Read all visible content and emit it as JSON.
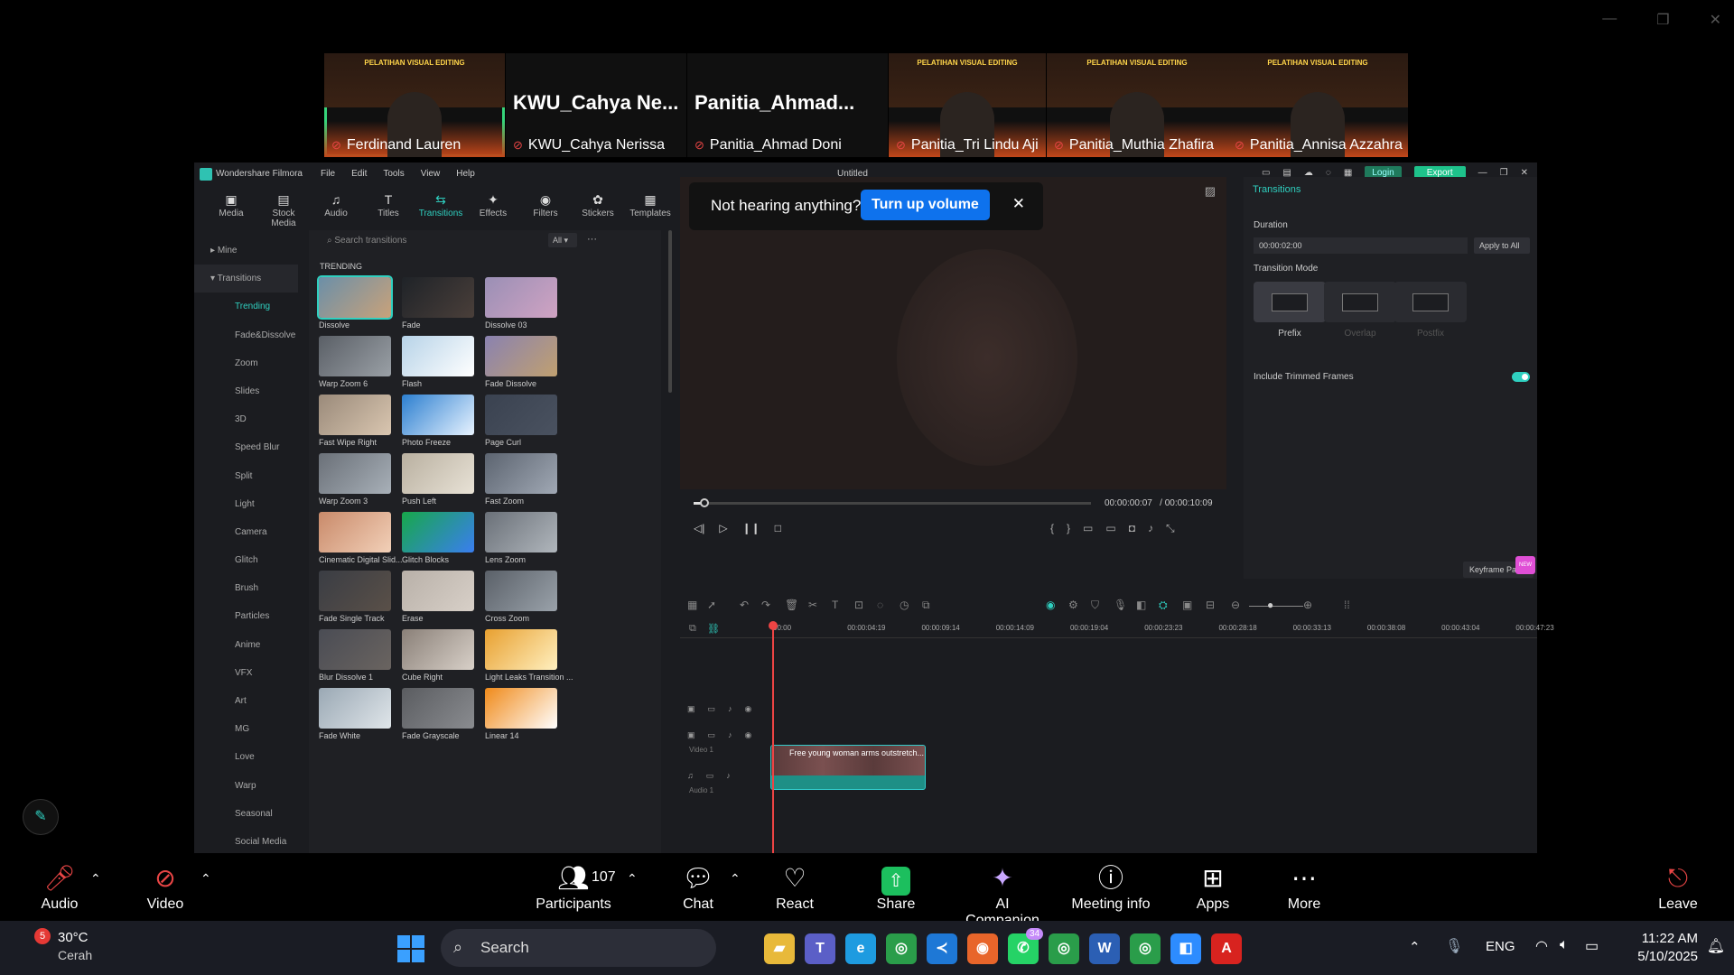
{
  "window_controls": [
    "—",
    "❐",
    "✕"
  ],
  "gallery": {
    "tiles": [
      {
        "name": "Ferdinand Lauren",
        "banner": "PELATIHAN VISUAL EDITING",
        "speaking": true,
        "video": true
      },
      {
        "name": "KWU_Cahya Nerissa",
        "big": "KWU_Cahya  Ne...",
        "video": false
      },
      {
        "name": "Panitia_Ahmad Doni",
        "big": "Panitia_Ahmad...",
        "video": false
      },
      {
        "name": "Panitia_Tri Lindu Aji",
        "banner": "PELATIHAN VISUAL EDITING",
        "video": true
      },
      {
        "name": "Panitia_Muthia Zhafira",
        "banner": "PELATIHAN VISUAL EDITING",
        "video": true
      },
      {
        "name": "Panitia_Annisa Azzahra",
        "banner": "PELATIHAN VISUAL EDITING",
        "video": true
      }
    ]
  },
  "filmora": {
    "app_name": "Wondershare Filmora",
    "menu": [
      "File",
      "Edit",
      "Tools",
      "View",
      "Help"
    ],
    "doc_title": "Untitled",
    "login": "Login",
    "export": "Export",
    "toolbar": [
      {
        "label": "Media",
        "icon": "▣"
      },
      {
        "label": "Stock Media",
        "icon": "▤"
      },
      {
        "label": "Audio",
        "icon": "♫"
      },
      {
        "label": "Titles",
        "icon": "T"
      },
      {
        "label": "Transitions",
        "icon": "⇆",
        "active": true
      },
      {
        "label": "Effects",
        "icon": "✦"
      },
      {
        "label": "Filters",
        "icon": "◉"
      },
      {
        "label": "Stickers",
        "icon": "✿"
      },
      {
        "label": "Templates",
        "icon": "▦"
      }
    ],
    "nav": {
      "mine": "Mine",
      "transitions": "Transitions",
      "items": [
        "Trending",
        "Fade&Dissolve",
        "Zoom",
        "Slides",
        "3D",
        "Speed Blur",
        "Split",
        "Light",
        "Camera",
        "Glitch",
        "Brush",
        "Particles",
        "Anime",
        "VFX",
        "Art",
        "MG",
        "Love",
        "Warp",
        "Seasonal",
        "Social Media"
      ]
    },
    "search_placeholder": "Search transitions",
    "filter": "All",
    "trending_header": "TRENDING",
    "transitions": [
      {
        "label": "Dissolve",
        "c1": "#6b8fa8",
        "c2": "#c9a27a"
      },
      {
        "label": "Fade",
        "c1": "#1f2328",
        "c2": "#4a3f3a"
      },
      {
        "label": "Dissolve 03",
        "c1": "#9a8fb5",
        "c2": "#d0a3c3"
      },
      {
        "label": "Warp Zoom 6",
        "c1": "#5a5f66",
        "c2": "#9aa0a6"
      },
      {
        "label": "Flash",
        "c1": "#b7d3e8",
        "c2": "#ffffff"
      },
      {
        "label": "Fade Dissolve",
        "c1": "#8a82b0",
        "c2": "#c0a070"
      },
      {
        "label": "Fast Wipe Right",
        "c1": "#9a8a7a",
        "c2": "#d9c6b0"
      },
      {
        "label": "Photo Freeze",
        "c1": "#2c7fd0",
        "c2": "#e8f3ff"
      },
      {
        "label": "Page Curl",
        "c1": "#3a4250",
        "c2": "#4a5260"
      },
      {
        "label": "Warp Zoom 3",
        "c1": "#6a7078",
        "c2": "#a8b0b8"
      },
      {
        "label": "Push Left",
        "c1": "#b9b0a0",
        "c2": "#e8e2d6"
      },
      {
        "label": "Fast Zoom",
        "c1": "#5c6470",
        "c2": "#a0a8b4"
      },
      {
        "label": "Cinematic Digital Slid...",
        "c1": "#c98a6a",
        "c2": "#f2d0b8"
      },
      {
        "label": "Glitch Blocks",
        "c1": "#17a84a",
        "c2": "#3a7ef0"
      },
      {
        "label": "Lens Zoom",
        "c1": "#6a7078",
        "c2": "#b0b6bc"
      },
      {
        "label": "Fade Single Track",
        "c1": "#3a3d44",
        "c2": "#5a5048"
      },
      {
        "label": "Erase",
        "c1": "#b8b0a8",
        "c2": "#d8d0c8"
      },
      {
        "label": "Cross Zoom",
        "c1": "#5a6068",
        "c2": "#9aa2aa"
      },
      {
        "label": "Blur Dissolve 1",
        "c1": "#4a4c54",
        "c2": "#6a6460"
      },
      {
        "label": "Cube Right",
        "c1": "#8a8078",
        "c2": "#d8d0c8"
      },
      {
        "label": "Light Leaks Transition ...",
        "c1": "#e8a030",
        "c2": "#fff0c0"
      },
      {
        "label": "Fade White",
        "c1": "#9aa8b4",
        "c2": "#e0e6ea"
      },
      {
        "label": "Fade Grayscale",
        "c1": "#5a5c60",
        "c2": "#8a8c90"
      },
      {
        "label": "Linear 14",
        "c1": "#f08a1a",
        "c2": "#ffffff"
      }
    ],
    "notice": {
      "text": "Not hearing anything?",
      "button": "Turn up volume",
      "close": "✕"
    },
    "player": {
      "current": "00:00:00:07",
      "total": "/ 00:00:10:09",
      "progress": 0.022
    },
    "props": {
      "tab": "Transitions",
      "duration_label": "Duration",
      "duration": "00:00:02:00",
      "apply_all": "Apply to All",
      "mode_label": "Transition Mode",
      "modes": [
        "Prefix",
        "Overlap",
        "Postfix"
      ],
      "include_trimmed": "Include Trimmed Frames",
      "keyframe": "Keyframe Panel",
      "new_badge": "NEW"
    },
    "ruler": [
      "00:00",
      "00:00:04:19",
      "00:00:09:14",
      "00:00:14:09",
      "00:00:19:04",
      "00:00:23:23",
      "00:00:28:18",
      "00:00:33:13",
      "00:00:38:08",
      "00:00:43:04",
      "00:00:47:23"
    ],
    "tracks": {
      "video": "Video 1",
      "audio": "Audio 1",
      "clip": "Free young woman arms outstretch..."
    }
  },
  "zoom": {
    "audio": "Audio",
    "video": "Video",
    "participants": "Participants",
    "participants_count": "107",
    "chat": "Chat",
    "react": "React",
    "share": "Share",
    "ai": "AI Companion",
    "meeting_info": "Meeting info",
    "apps": "Apps",
    "more": "More",
    "leave": "Leave"
  },
  "taskbar": {
    "weather_badge": "5",
    "temp": "30°C",
    "condition": "Cerah",
    "search": "Search",
    "whatsapp_badge": "34",
    "lang": "ENG",
    "time": "11:22 AM",
    "date": "5/10/2025",
    "apps": [
      {
        "name": "file-explorer",
        "glyph": "▰",
        "color": "#e8b93a"
      },
      {
        "name": "teams",
        "glyph": "T",
        "color": "#5b5fc7"
      },
      {
        "name": "edge",
        "glyph": "e",
        "color": "#1e9be0"
      },
      {
        "name": "chrome",
        "glyph": "◎",
        "color": "#2a9d4a"
      },
      {
        "name": "vscode",
        "glyph": "≺",
        "color": "#1e78d6"
      },
      {
        "name": "firefox",
        "glyph": "◉",
        "color": "#e8652a"
      },
      {
        "name": "whatsapp",
        "glyph": "✆",
        "color": "#25d366"
      },
      {
        "name": "chrome-2",
        "glyph": "◎",
        "color": "#2a9d4a"
      },
      {
        "name": "word",
        "glyph": "W",
        "color": "#2b5fb4"
      },
      {
        "name": "chrome-3",
        "glyph": "◎",
        "color": "#2a9d4a"
      },
      {
        "name": "zoom",
        "glyph": "◧",
        "color": "#2d8cff"
      },
      {
        "name": "acrobat",
        "glyph": "A",
        "color": "#d8231f"
      }
    ]
  }
}
